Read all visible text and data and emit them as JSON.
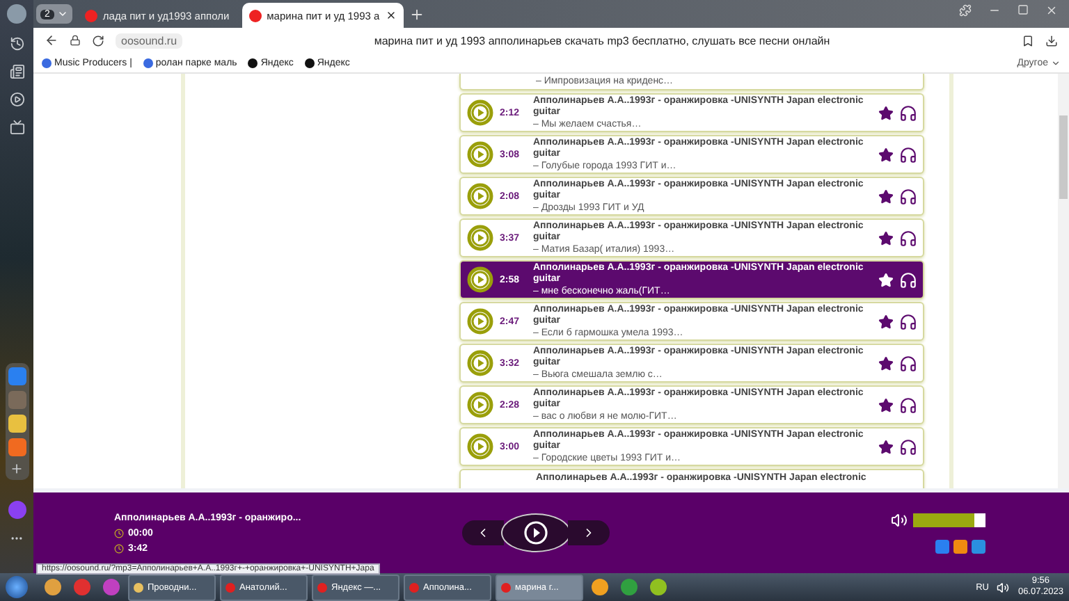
{
  "browser": {
    "tab_group": "2",
    "tabs": [
      {
        "title": "лада пит и уд1993 апполи",
        "selected": false
      },
      {
        "title": "марина пит и уд 1993 а",
        "selected": true
      }
    ],
    "address": "oosound.ru",
    "page_title": "марина пит и уд 1993 апполинарьев скачать mp3 бесплатно, слушать все песни онлайн",
    "bookmarks": [
      "Music Producers |",
      "ролан парке маль",
      "Яндекс",
      "Яндекс"
    ],
    "bookmarks_more": "Другое"
  },
  "tracks": [
    {
      "kind": "partial-top",
      "subtitle": "– Импровизация на криденс…"
    },
    {
      "kind": "track",
      "duration": "2:12",
      "title": "Апполинарьев А.А..1993г - оранжировка -UNISYNTH Japan electronic guitar",
      "subtitle": "– Мы желаем счастья…",
      "selected": false
    },
    {
      "kind": "track",
      "duration": "3:08",
      "title": "Апполинарьев А.А..1993г - оранжировка -UNISYNTH Japan electronic guitar",
      "subtitle": "– Голубые города 1993 ГИТ и…",
      "selected": false
    },
    {
      "kind": "track",
      "duration": "2:08",
      "title": "Апполинарьев А.А..1993г - оранжировка -UNISYNTH Japan electronic guitar",
      "subtitle": "– Дрозды 1993 ГИТ и УД",
      "selected": false
    },
    {
      "kind": "track",
      "duration": "3:37",
      "title": "Апполинарьев А.А..1993г - оранжировка -UNISYNTH Japan electronic guitar",
      "subtitle": "– Матия Базар( италия) 1993…",
      "selected": false
    },
    {
      "kind": "track",
      "duration": "2:58",
      "title": "Апполинарьев А.А..1993г - оранжировка -UNISYNTH Japan electronic guitar",
      "subtitle": "– мне бесконечно жаль(ГИТ…",
      "selected": true
    },
    {
      "kind": "track",
      "duration": "2:47",
      "title": "Апполинарьев А.А..1993г - оранжировка -UNISYNTH Japan electronic guitar",
      "subtitle": "– Если б гармошка умела 1993…",
      "selected": false
    },
    {
      "kind": "track",
      "duration": "3:32",
      "title": "Апполинарьев А.А..1993г - оранжировка -UNISYNTH Japan electronic guitar",
      "subtitle": "– Вьюга смешала землю с…",
      "selected": false
    },
    {
      "kind": "track",
      "duration": "2:28",
      "title": "Апполинарьев А.А..1993г - оранжировка -UNISYNTH Japan electronic guitar",
      "subtitle": "– вас о любви я не молю-ГИТ…",
      "selected": false
    },
    {
      "kind": "track",
      "duration": "3:00",
      "title": "Апполинарьев А.А..1993г - оранжировка -UNISYNTH Japan electronic guitar",
      "subtitle": "– Городские цветы 1993 ГИТ и…",
      "selected": false
    },
    {
      "kind": "partial-bottom",
      "title": "Апполинарьев А.А..1993г - оранжировка -UNISYNTH Japan electronic"
    }
  ],
  "player": {
    "now_playing": "Апполинарьев А.А..1993г - оранжиро...",
    "elapsed": "00:00",
    "total": "3:42",
    "volume": {
      "level": 0.84
    }
  },
  "status_url": "https://oosound.ru/?mp3=Апполинарьев+А.А..1993г+-+оранжировка+-UNISYNTH+Japa",
  "taskbar": {
    "tasks": [
      {
        "label": "Проводни...",
        "selected": false
      },
      {
        "label": "Анатолий...",
        "selected": false
      },
      {
        "label": "Яндекс —...",
        "selected": false
      },
      {
        "label": "Апполина...",
        "selected": false
      },
      {
        "label": "марина г...",
        "selected": true
      }
    ],
    "language": "RU",
    "time": "9:56",
    "date": "06.07.2023"
  }
}
